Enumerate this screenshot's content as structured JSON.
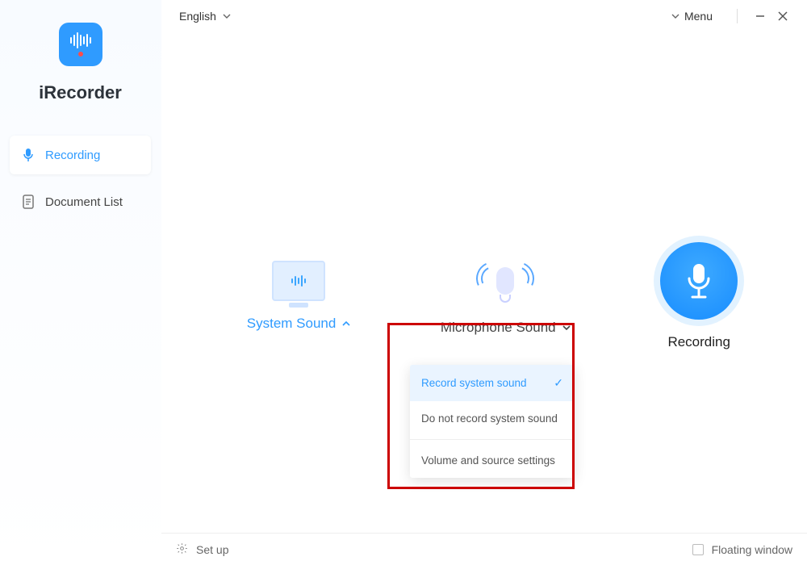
{
  "sidebar": {
    "app_name": "iRecorder",
    "items": [
      {
        "label": "Recording",
        "icon": "microphone-icon"
      },
      {
        "label": "Document List",
        "icon": "document-icon"
      }
    ]
  },
  "titlebar": {
    "language": "English",
    "menu_label": "Menu"
  },
  "sources": {
    "system": {
      "label": "System Sound",
      "dropdown_open": true,
      "options": [
        {
          "label": "Record system sound",
          "selected": true
        },
        {
          "label": "Do not record system sound",
          "selected": false
        },
        {
          "label": "Volume and source settings",
          "selected": false
        }
      ]
    },
    "microphone": {
      "label": "Microphone Sound"
    },
    "record_button": {
      "label": "Recording"
    }
  },
  "footer": {
    "setup_label": "Set up",
    "floating_label": "Floating window",
    "floating_checked": false
  },
  "colors": {
    "accent": "#2f9bff",
    "highlight_border": "#cc0000"
  }
}
